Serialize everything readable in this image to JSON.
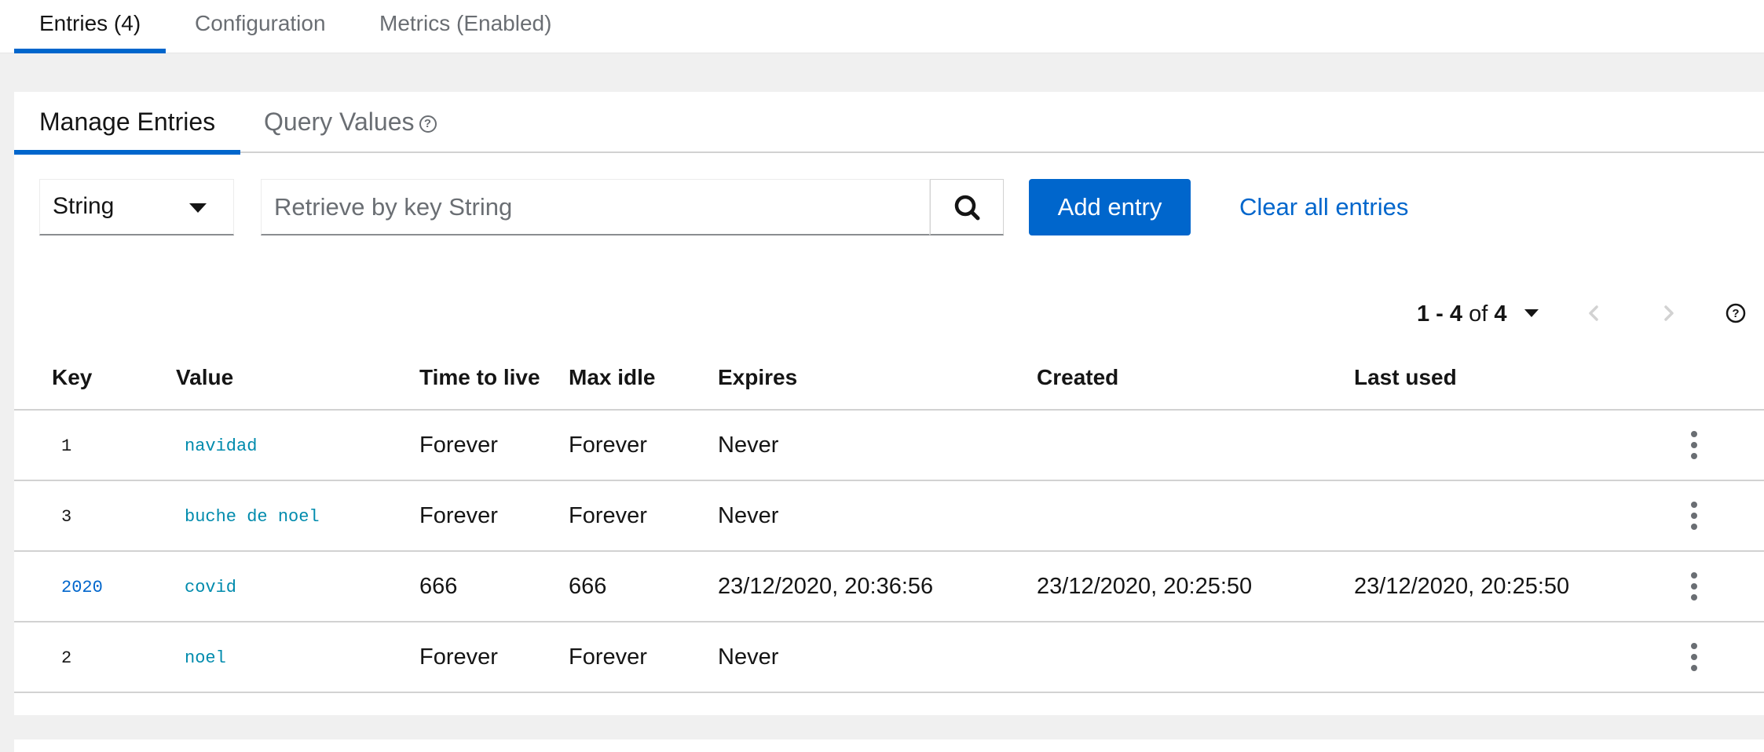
{
  "top_tabs": [
    {
      "label": "Entries (4)",
      "active": true
    },
    {
      "label": "Configuration",
      "active": false
    },
    {
      "label": "Metrics (Enabled)",
      "active": false
    }
  ],
  "sub_tabs": [
    {
      "label": "Manage Entries",
      "active": true
    },
    {
      "label": "Query Values",
      "active": false,
      "icon": "help-icon"
    }
  ],
  "toolbar": {
    "key_type": "String",
    "search_placeholder": "Retrieve by key String",
    "add_label": "Add entry",
    "clear_label": "Clear all entries"
  },
  "pagination": {
    "range": "1 - 4",
    "of_label": "of",
    "total": "4"
  },
  "table": {
    "columns": [
      "Key",
      "Value",
      "Time to live",
      "Max idle",
      "Expires",
      "Created",
      "Last used"
    ],
    "rows": [
      {
        "key": "1",
        "value": "navidad",
        "ttl": "Forever",
        "max_idle": "Forever",
        "expires": "Never",
        "created": "",
        "last_used": ""
      },
      {
        "key": "3",
        "value": "buche de noel",
        "ttl": "Forever",
        "max_idle": "Forever",
        "expires": "Never",
        "created": "",
        "last_used": ""
      },
      {
        "key": "2020",
        "value": "covid",
        "ttl": "666",
        "max_idle": "666",
        "expires": "23/12/2020, 20:36:56",
        "created": "23/12/2020, 20:25:50",
        "last_used": "23/12/2020, 20:25:50"
      },
      {
        "key": "2",
        "value": "noel",
        "ttl": "Forever",
        "max_idle": "Forever",
        "expires": "Never",
        "created": "",
        "last_used": ""
      }
    ]
  },
  "colors": {
    "accent": "#0066cc",
    "value_text": "#008bad",
    "background": "#f0f0f0"
  }
}
